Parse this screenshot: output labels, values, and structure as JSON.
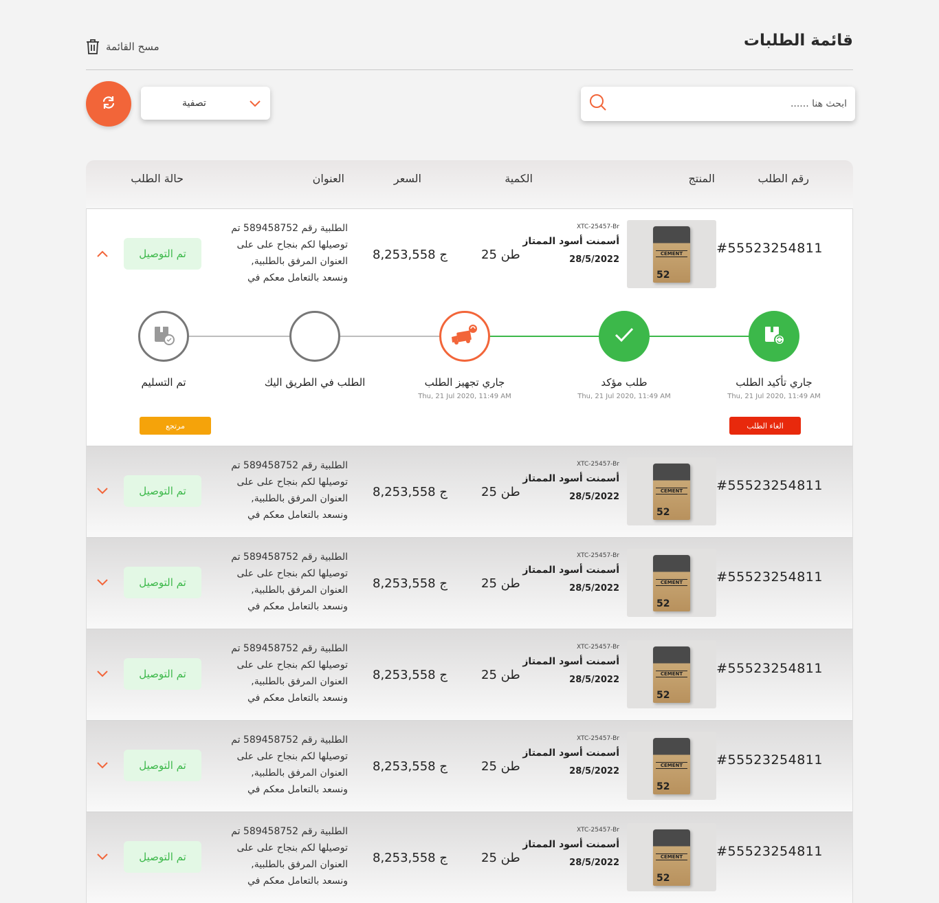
{
  "header": {
    "title": "قائمة الطلبات",
    "clear_label": "مسح القائمة"
  },
  "search": {
    "placeholder": "ابحث هنا ......"
  },
  "filter": {
    "label": "تصفية"
  },
  "columns": {
    "order_id": "رقم الطلب",
    "product": "المنتج",
    "quantity": "الكمية",
    "price": "السعر",
    "address": "العنوان",
    "status": "حالة الطلب"
  },
  "colors": {
    "accent": "#f26539",
    "success": "#3cb84a",
    "danger": "#e8290c",
    "warning": "#f5a30a"
  },
  "rows": [
    {
      "order_id": "#55523254811",
      "product_code": "XTC-25457-Br",
      "product_name": "أسمنت أسود الممتاز",
      "product_date": "28/5/2022",
      "bag_text": "CEMENT",
      "bag_num": "52",
      "quantity": "25 طن",
      "price": "8,253,558 ج",
      "address": "الطلبية رقم 589458752 تم توصيلها لكم بنجاح على على العنوان المرفق بالطلبية, ونسعد بالتعامل معكم في",
      "status": "تم التوصيل",
      "expanded": true,
      "timeline": [
        {
          "label": "جاري تأكيد الطلب",
          "time": "Thu, 21 Jul 2020, 11:49 AM",
          "state": "done",
          "icon": "box-refresh-icon"
        },
        {
          "label": "طلب مؤكد",
          "time": "Thu, 21 Jul 2020, 11:49 AM",
          "state": "done",
          "icon": "check-icon"
        },
        {
          "label": "جاري تجهيز الطلب",
          "time": "Thu, 21 Jul 2020, 11:49 AM",
          "state": "current",
          "icon": "truck-icon"
        },
        {
          "label": "الطلب في الطريق اليك",
          "time": "",
          "state": "pending",
          "icon": ""
        },
        {
          "label": "تم التسليم",
          "time": "",
          "state": "pending",
          "icon": "box-check-icon"
        }
      ],
      "cancel_label": "الغاء الطلب",
      "return_label": "مرتجع"
    },
    {
      "order_id": "#55523254811",
      "product_code": "XTC-25457-Br",
      "product_name": "أسمنت أسود الممتاز",
      "product_date": "28/5/2022",
      "bag_text": "CEMENT",
      "bag_num": "52",
      "quantity": "25 طن",
      "price": "8,253,558 ج",
      "address": "الطلبية رقم 589458752 تم توصيلها لكم بنجاح على على العنوان المرفق بالطلبية, ونسعد بالتعامل معكم في",
      "status": "تم التوصيل",
      "expanded": false
    },
    {
      "order_id": "#55523254811",
      "product_code": "XTC-25457-Br",
      "product_name": "أسمنت أسود الممتاز",
      "product_date": "28/5/2022",
      "bag_text": "CEMENT",
      "bag_num": "52",
      "quantity": "25 طن",
      "price": "8,253,558 ج",
      "address": "الطلبية رقم 589458752 تم توصيلها لكم بنجاح على على العنوان المرفق بالطلبية, ونسعد بالتعامل معكم في",
      "status": "تم التوصيل",
      "expanded": false
    },
    {
      "order_id": "#55523254811",
      "product_code": "XTC-25457-Br",
      "product_name": "أسمنت أسود الممتاز",
      "product_date": "28/5/2022",
      "bag_text": "CEMENT",
      "bag_num": "52",
      "quantity": "25 طن",
      "price": "8,253,558 ج",
      "address": "الطلبية رقم 589458752 تم توصيلها لكم بنجاح على على العنوان المرفق بالطلبية, ونسعد بالتعامل معكم في",
      "status": "تم التوصيل",
      "expanded": false
    },
    {
      "order_id": "#55523254811",
      "product_code": "XTC-25457-Br",
      "product_name": "أسمنت أسود الممتاز",
      "product_date": "28/5/2022",
      "bag_text": "CEMENT",
      "bag_num": "52",
      "quantity": "25 طن",
      "price": "8,253,558 ج",
      "address": "الطلبية رقم 589458752 تم توصيلها لكم بنجاح على على العنوان المرفق بالطلبية, ونسعد بالتعامل معكم في",
      "status": "تم التوصيل",
      "expanded": false
    },
    {
      "order_id": "#55523254811",
      "product_code": "XTC-25457-Br",
      "product_name": "أسمنت أسود الممتاز",
      "product_date": "28/5/2022",
      "bag_text": "CEMENT",
      "bag_num": "52",
      "quantity": "25 طن",
      "price": "8,253,558 ج",
      "address": "الطلبية رقم 589458752 تم توصيلها لكم بنجاح على على العنوان المرفق بالطلبية, ونسعد بالتعامل معكم في",
      "status": "تم التوصيل",
      "expanded": false
    }
  ]
}
